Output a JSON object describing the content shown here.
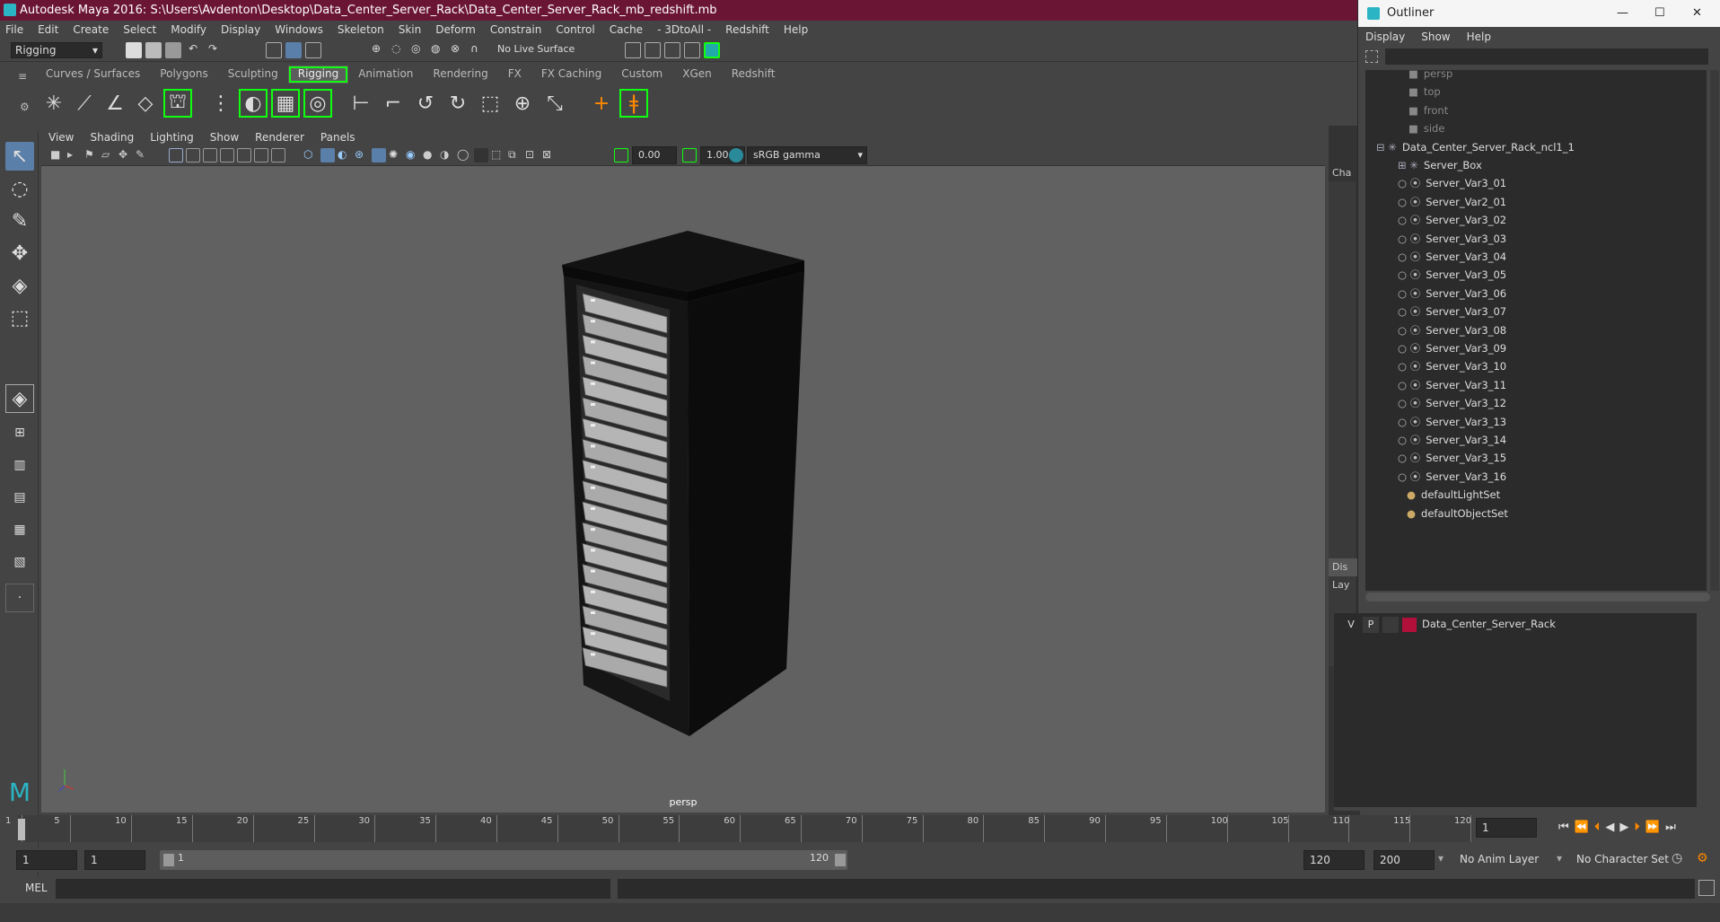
{
  "window_title": "Autodesk Maya 2016: S:\\Users\\Avdenton\\Desktop\\Data_Center_Server_Rack\\Data_Center_Server_Rack_mb_redshift.mb",
  "menu": [
    "File",
    "Edit",
    "Create",
    "Select",
    "Modify",
    "Display",
    "Windows",
    "Skeleton",
    "Skin",
    "Deform",
    "Constrain",
    "Control",
    "Cache",
    "- 3DtoAll -",
    "Redshift",
    "Help"
  ],
  "status": {
    "mode": "Rigging",
    "live_surface": "No Live Surface"
  },
  "shelf_tabs": [
    "Curves / Surfaces",
    "Polygons",
    "Sculpting",
    "Rigging",
    "Animation",
    "Rendering",
    "FX",
    "FX Caching",
    "Custom",
    "XGen",
    "Redshift"
  ],
  "active_shelf": "Rigging",
  "viewport": {
    "menu": [
      "View",
      "Shading",
      "Lighting",
      "Show",
      "Renderer",
      "Panels"
    ],
    "value_a": "0.00",
    "value_b": "1.00",
    "color_space": "sRGB gamma",
    "camera": "persp"
  },
  "right_tabs": {
    "channel": "Cha",
    "display": "Dis",
    "layers": "Lay"
  },
  "timeline": {
    "ticks": [
      "1",
      "5",
      "10",
      "15",
      "20",
      "25",
      "30",
      "35",
      "40",
      "45",
      "50",
      "55",
      "60",
      "65",
      "70",
      "75",
      "80",
      "85",
      "90",
      "95",
      "100",
      "105",
      "110",
      "115",
      "120"
    ],
    "current_frame": "1"
  },
  "range": {
    "start": "1",
    "start2": "1",
    "slider_start": "1",
    "slider_end": "120",
    "end": "120",
    "max": "200",
    "anim_layer": "No Anim Layer",
    "char_set": "No Character Set"
  },
  "cmd": {
    "label": "MEL"
  },
  "outliner": {
    "title": "Outliner",
    "menu": [
      "Display",
      "Show",
      "Help"
    ],
    "cameras": [
      "persp",
      "top",
      "front",
      "side"
    ],
    "group": "Data_Center_Server_Rack_ncl1_1",
    "children": [
      "Server_Box",
      "Server_Var3_01",
      "Server_Var2_01",
      "Server_Var3_02",
      "Server_Var3_03",
      "Server_Var3_04",
      "Server_Var3_05",
      "Server_Var3_06",
      "Server_Var3_07",
      "Server_Var3_08",
      "Server_Var3_09",
      "Server_Var3_10",
      "Server_Var3_11",
      "Server_Var3_12",
      "Server_Var3_13",
      "Server_Var3_14",
      "Server_Var3_15",
      "Server_Var3_16"
    ],
    "sets": [
      "defaultLightSet",
      "defaultObjectSet"
    ]
  },
  "layer": {
    "v": "V",
    "p": "P",
    "name": "Data_Center_Server_Rack",
    "color": "#b0103a"
  }
}
